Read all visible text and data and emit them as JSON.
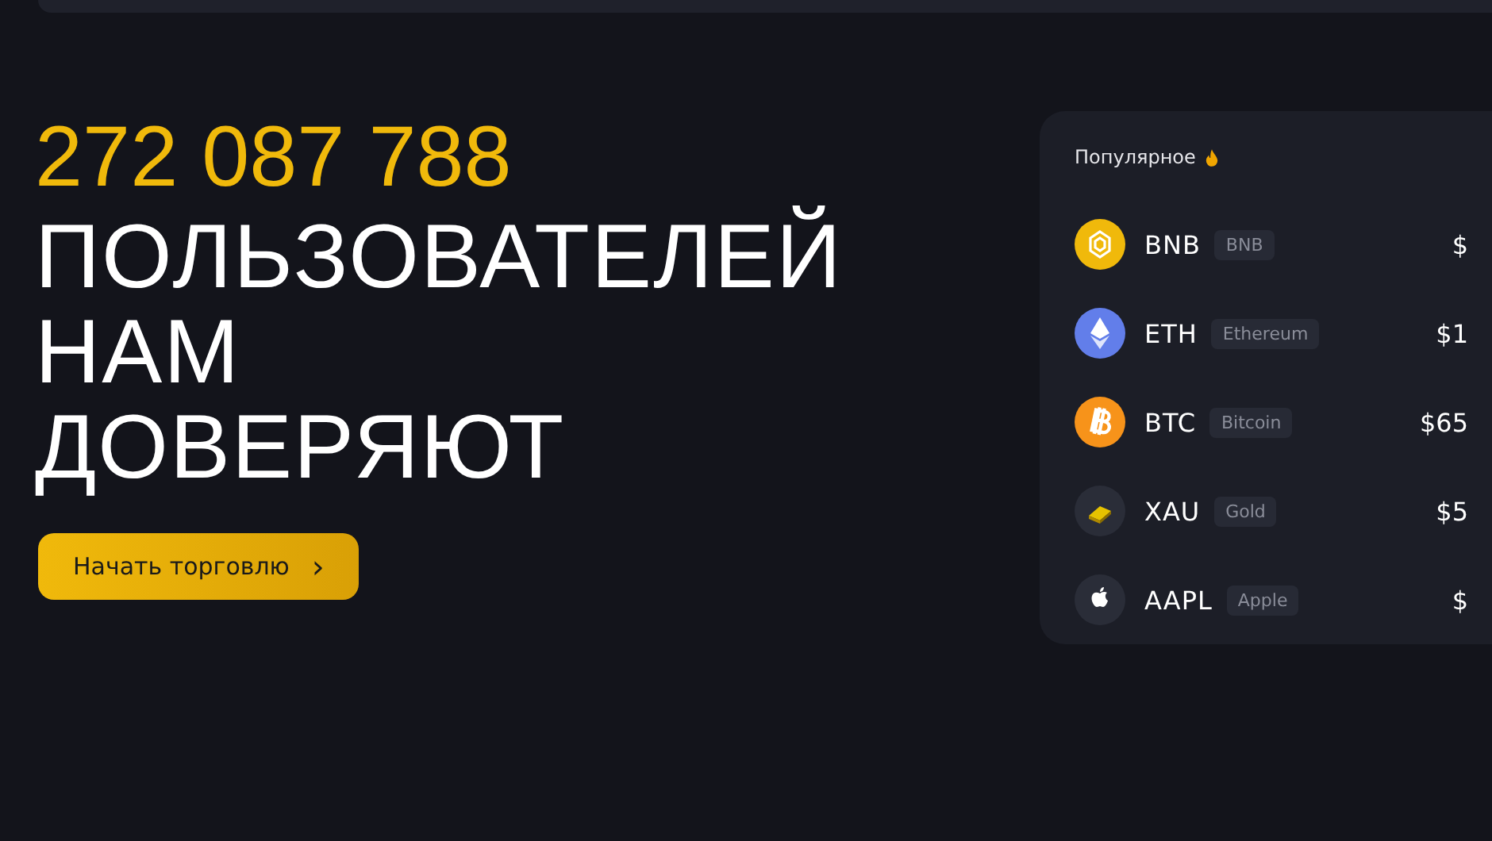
{
  "hero": {
    "count": "272 087 788",
    "lines": [
      "ПОЛЬЗОВАТЕЛЕЙ",
      "НАМ",
      "ДОВЕРЯЮТ"
    ],
    "button": {
      "label": "Начать торговлю",
      "arrow": "›"
    }
  },
  "popular": {
    "title": "Популярное",
    "items": [
      {
        "kind": "bnb",
        "symbol": "BNB",
        "tag": "BNB",
        "price": "$"
      },
      {
        "kind": "eth",
        "symbol": "ETH",
        "tag": "Ethereum",
        "price": "$1"
      },
      {
        "kind": "btc",
        "symbol": "BTC",
        "tag": "Bitcoin",
        "price": "$65"
      },
      {
        "kind": "gold",
        "symbol": "XAU",
        "tag": "Gold",
        "price": "$5"
      },
      {
        "kind": "apple",
        "symbol": "AAPL",
        "tag": "Apple",
        "price": "$"
      }
    ]
  }
}
